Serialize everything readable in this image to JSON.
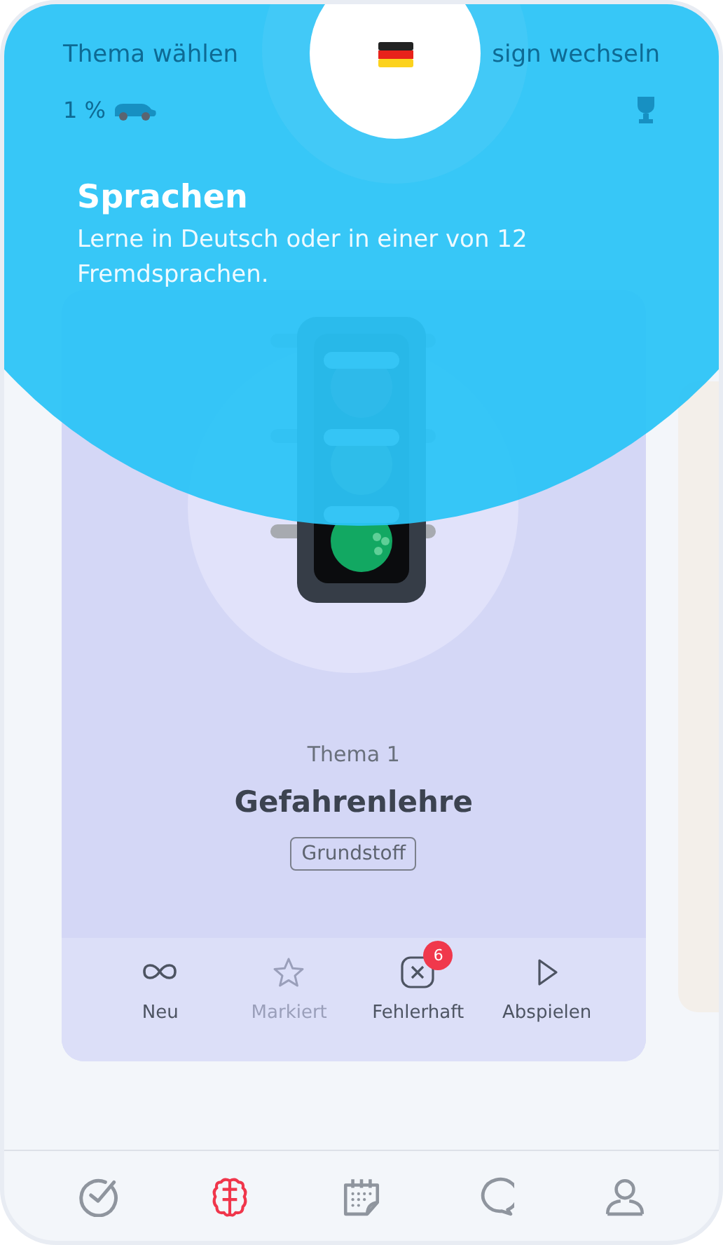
{
  "background": {
    "header": {
      "title": "Thema wählen",
      "action": "sign wechseln"
    },
    "progress": {
      "percent": "1 %"
    }
  },
  "card": {
    "topic_number": "Thema 1",
    "title": "Gefahrenlehre",
    "tag": "Grundstoff",
    "actions": [
      {
        "kind": "infinity",
        "label": "Neu",
        "disabled": false
      },
      {
        "kind": "star",
        "label": "Markiert",
        "disabled": true
      },
      {
        "kind": "mistakes",
        "label": "Fehlerhaft",
        "disabled": false,
        "badge": "6"
      },
      {
        "kind": "play",
        "label": "Abspielen",
        "disabled": false
      }
    ]
  },
  "tab_bar": [
    {
      "kind": "check",
      "selected": false
    },
    {
      "kind": "brain",
      "selected": true
    },
    {
      "kind": "calendar",
      "selected": false
    },
    {
      "kind": "chat",
      "selected": false
    },
    {
      "kind": "profile",
      "selected": false
    }
  ],
  "coach_mark": {
    "title": "Sprachen",
    "text": "Lerne in Deutsch oder in einer von 12 Fremdsprachen."
  }
}
